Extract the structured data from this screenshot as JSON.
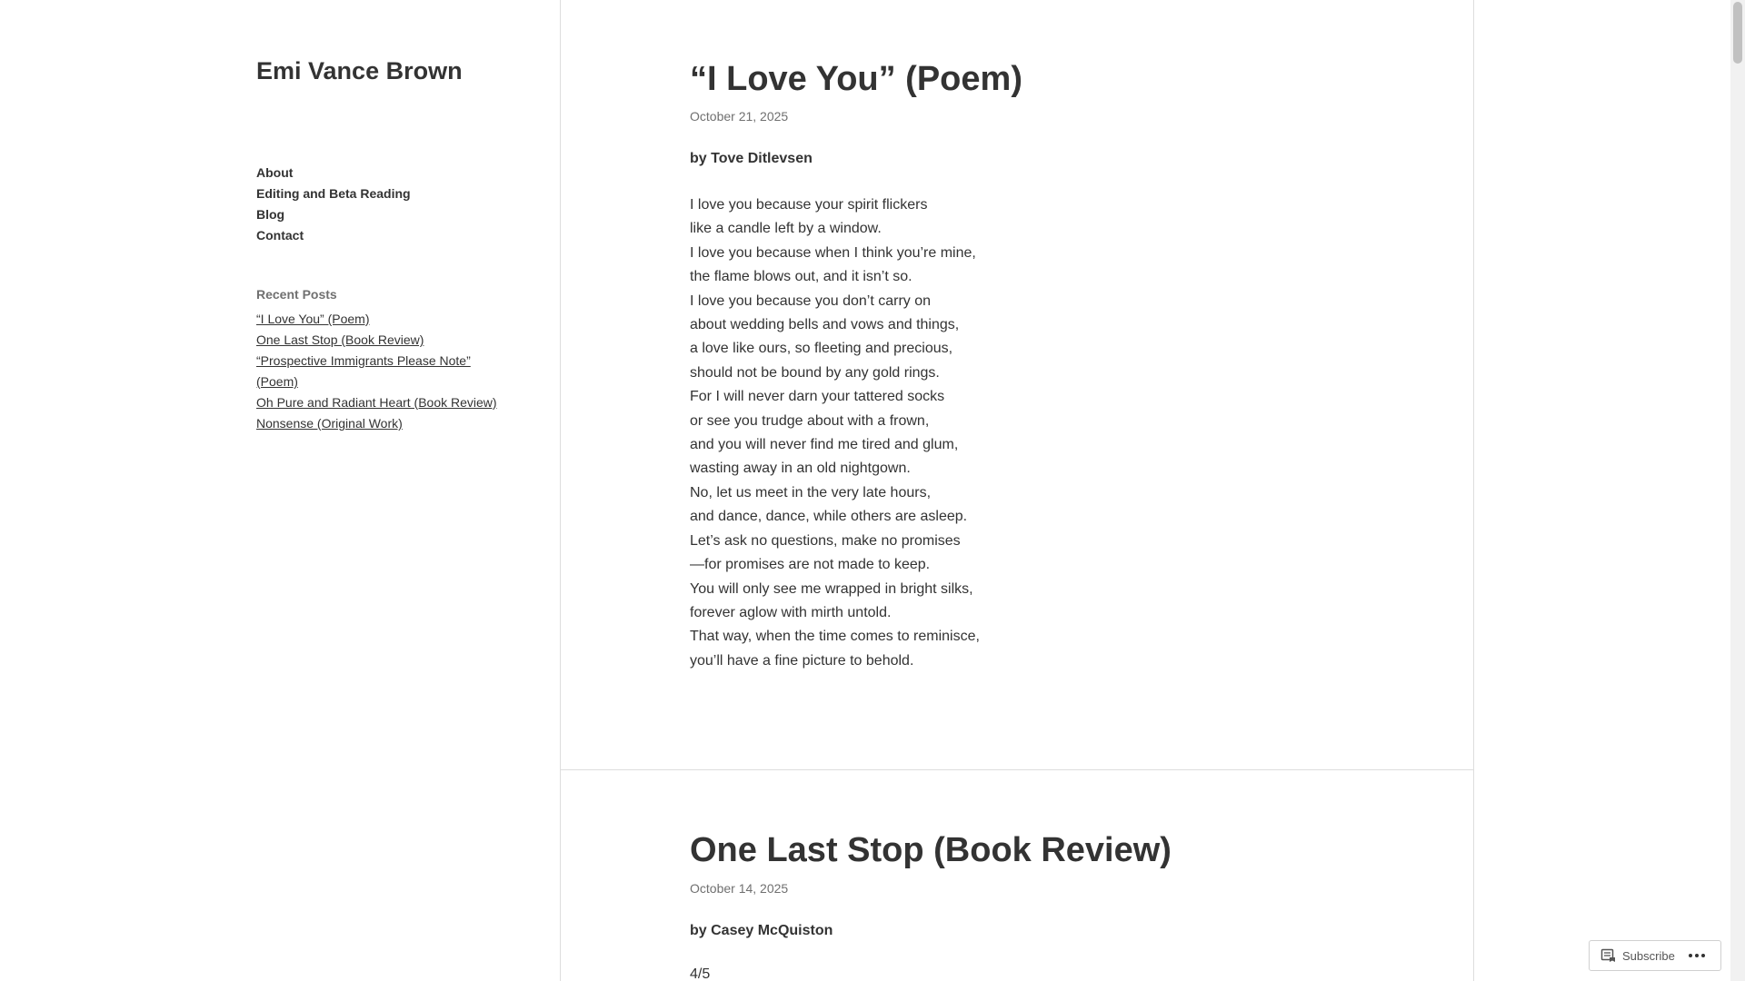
{
  "site": {
    "title": "Emi Vance Brown"
  },
  "nav": {
    "items": [
      {
        "label": "About"
      },
      {
        "label": "Editing and Beta Reading"
      },
      {
        "label": "Blog"
      },
      {
        "label": "Contact"
      }
    ]
  },
  "sidebar": {
    "recent_posts_title": "Recent Posts",
    "recent_posts": [
      "“I Love You” (Poem)",
      "One Last Stop (Book Review)",
      "“Prospective Immigrants Please Note” (Poem)",
      "Oh Pure and Radiant Heart (Book Review)",
      "Nonsense (Original Work)"
    ]
  },
  "posts": [
    {
      "title": "“I Love You” (Poem)",
      "date": "October 21, 2025",
      "byline": "by Tove Ditlevsen",
      "lines": [
        "I love you because your spirit flickers",
        "like a candle left by a window.",
        "I love you because when I think you’re mine,",
        "the flame blows out, and it isn’t so.",
        "I love you because you don’t carry on",
        "about wedding bells and vows and things,",
        "a love like ours, so fleeting and precious,",
        "should not be bound by any gold rings.",
        "For I will never darn your tattered socks",
        "or see you trudge about with a frown,",
        "and you will never find me tired and glum,",
        "wasting away in an old nightgown.",
        "No, let us meet in the very late hours,",
        "and dance, dance, while others are asleep.",
        "Let’s ask no questions, make no promises",
        "—for promises are not made to keep.",
        "You will only see me wrapped in bright silks,",
        "forever aglow with mirth untold.",
        "That way, when the time comes to reminisce,",
        "you’ll have a fine picture to behold."
      ]
    },
    {
      "title": "One Last Stop (Book Review)",
      "date": "October 14, 2025",
      "byline": "by Casey McQuiston",
      "rating": "4/5"
    }
  ],
  "subscribe": {
    "label": "Subscribe",
    "icon": "reader-icon",
    "more_icon": "ellipsis-icon"
  }
}
